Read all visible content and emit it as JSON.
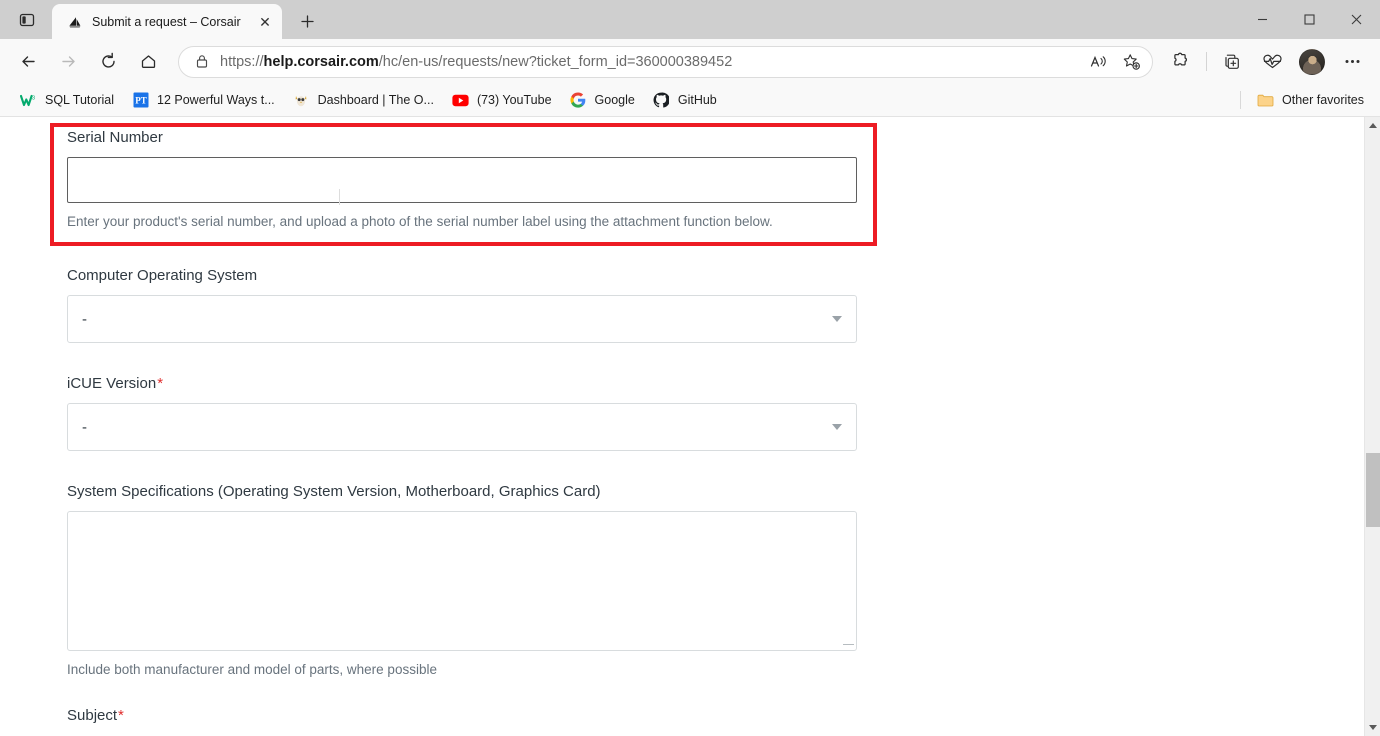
{
  "window": {
    "controls": {
      "minimize": "–",
      "maximize": "❐",
      "close": "✕"
    }
  },
  "tabstrip": {
    "sidebar_button_title": "Tab actions",
    "tab": {
      "title": "Submit a request – Corsair",
      "favicon": "corsair-sails-icon",
      "close_label": "✕"
    },
    "new_tab_label": "＋"
  },
  "navbar": {
    "back_label": "←",
    "forward_label": "→",
    "refresh_label": "⟳",
    "home_label": "⌂",
    "url_full": "https://help.corsair.com/hc/en-us/requests/new?ticket_form_id=360000389452",
    "url_scheme": "https://",
    "url_domain": "help.corsair.com",
    "url_path": "/hc/en-us/requests/new?ticket_form_id=360000389452",
    "read_aloud_label": "A",
    "favorite_label": "☆",
    "extensions_label": "extensions-icon",
    "collections_label": "collections-icon",
    "browser_essentials_label": "browser-essentials-icon",
    "profile_label": "profile-avatar",
    "settings_label": "⋯"
  },
  "bookmarks": {
    "items": [
      {
        "label": "SQL Tutorial",
        "icon": "w3schools-icon",
        "icon_glyph": "W",
        "icon_color": "#04aa6d"
      },
      {
        "label": "12 Powerful Ways t...",
        "icon": "pt-icon",
        "icon_glyph": "PT",
        "icon_color": "#1a73e8"
      },
      {
        "label": "Dashboard | The O...",
        "icon": "owl-icon",
        "icon_glyph": "🦉",
        "icon_color": "#e8b93a"
      },
      {
        "label": "(73) YouTube",
        "icon": "youtube-icon",
        "icon_glyph": "▶",
        "icon_color": "#ff0000"
      },
      {
        "label": "Google",
        "icon": "google-icon",
        "icon_glyph": "G",
        "icon_color": "#4285f4"
      },
      {
        "label": "GitHub",
        "icon": "github-icon",
        "icon_glyph": "●",
        "icon_color": "#1b1f23"
      }
    ],
    "other_favorites": {
      "label": "Other favorites",
      "icon": "folder-icon"
    }
  },
  "form": {
    "serial_number": {
      "label": "Serial Number",
      "value": "",
      "placeholder": "",
      "hint": "Enter your product's serial number, and upload a photo of the serial number label using the attachment function below.",
      "highlighted": true,
      "highlight_color": "#ed1c24"
    },
    "operating_system": {
      "label": "Computer Operating System",
      "selected": "-",
      "required": false
    },
    "icue_version": {
      "label": "iCUE Version",
      "selected": "-",
      "required": true,
      "required_marker": "*"
    },
    "system_specifications": {
      "label": "System Specifications (Operating System Version, Motherboard, Graphics Card)",
      "value": "",
      "hint": "Include both manufacturer and model of parts, where possible"
    },
    "subject": {
      "label": "Subject",
      "required": true,
      "required_marker": "*"
    }
  },
  "scrollbar": {
    "up_arrow": "▲",
    "down_arrow": "▼"
  }
}
